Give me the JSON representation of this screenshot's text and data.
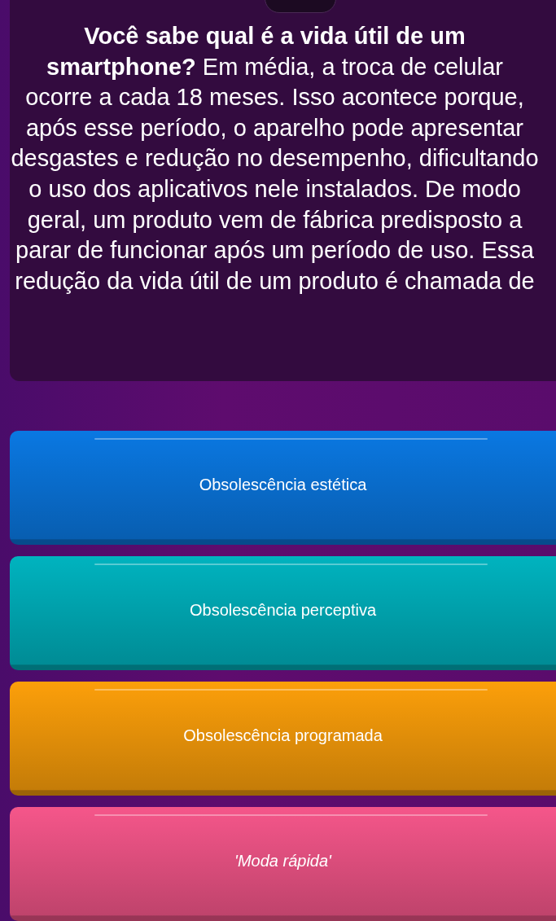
{
  "question": {
    "text": "**Você sabe qual é a vida útil de um smartphone?** Em média, a troca de celular ocorre a cada 18 meses. Isso acontece porque, após esse período, o aparelho pode apresentar desgastes e redução no desempenho, dificultando o uso dos aplicativos nele instalados. De modo geral, um produto vem de fábrica predisposto a parar de funcionar após um período de uso. Essa redução da vida útil de um produto é chamada de"
  },
  "options": [
    {
      "label": "Obsolescência estética",
      "color": "#0a78e2",
      "italic": false
    },
    {
      "label": "Obsolescência perceptiva",
      "color": "#00b3bf",
      "italic": false
    },
    {
      "label": "Obsolescência programada",
      "color": "#fc9f0a",
      "italic": false
    },
    {
      "label": "'Moda rápida'",
      "color": "#f5568a",
      "italic": true
    }
  ]
}
